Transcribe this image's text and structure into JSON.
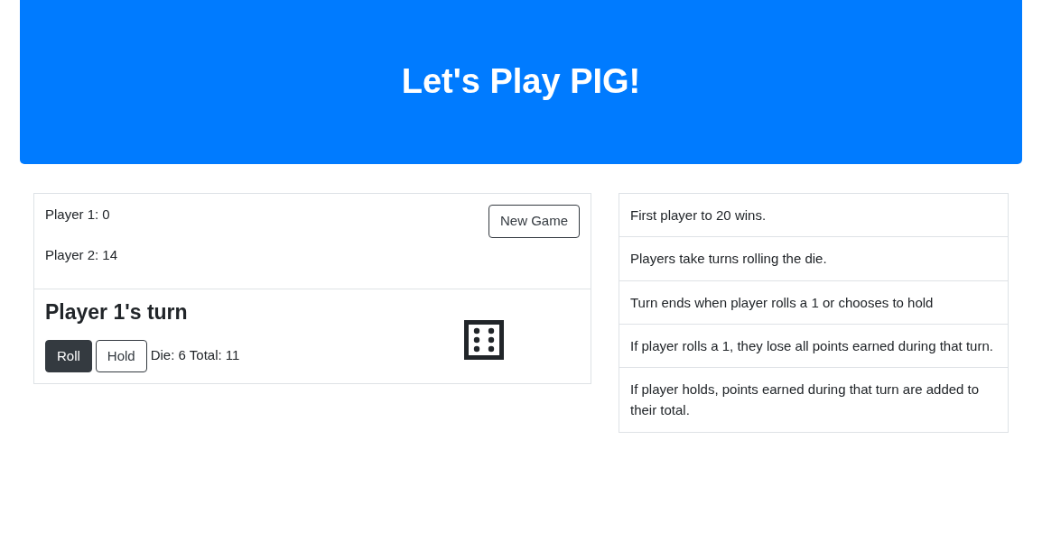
{
  "header": {
    "title": "Let's Play PIG!"
  },
  "scores": [
    {
      "label": "Player 1: 0"
    },
    {
      "label": "Player 2: 14"
    }
  ],
  "new_game_button": "New Game",
  "turn": {
    "heading": "Player 1's turn",
    "buttons": [
      {
        "label": "Roll",
        "kind": "filled"
      },
      {
        "label": "Hold",
        "kind": "outline"
      }
    ],
    "status": "Die: 6 Total: 11"
  },
  "rules": [
    "First player to 20 wins.",
    "Players take turns rolling the die.",
    "Turn ends when player rolls a 1 or chooses to hold",
    "If player rolls a 1, they lose all points earned during that turn.",
    "If player holds, points earned during that turn are added to their total."
  ]
}
